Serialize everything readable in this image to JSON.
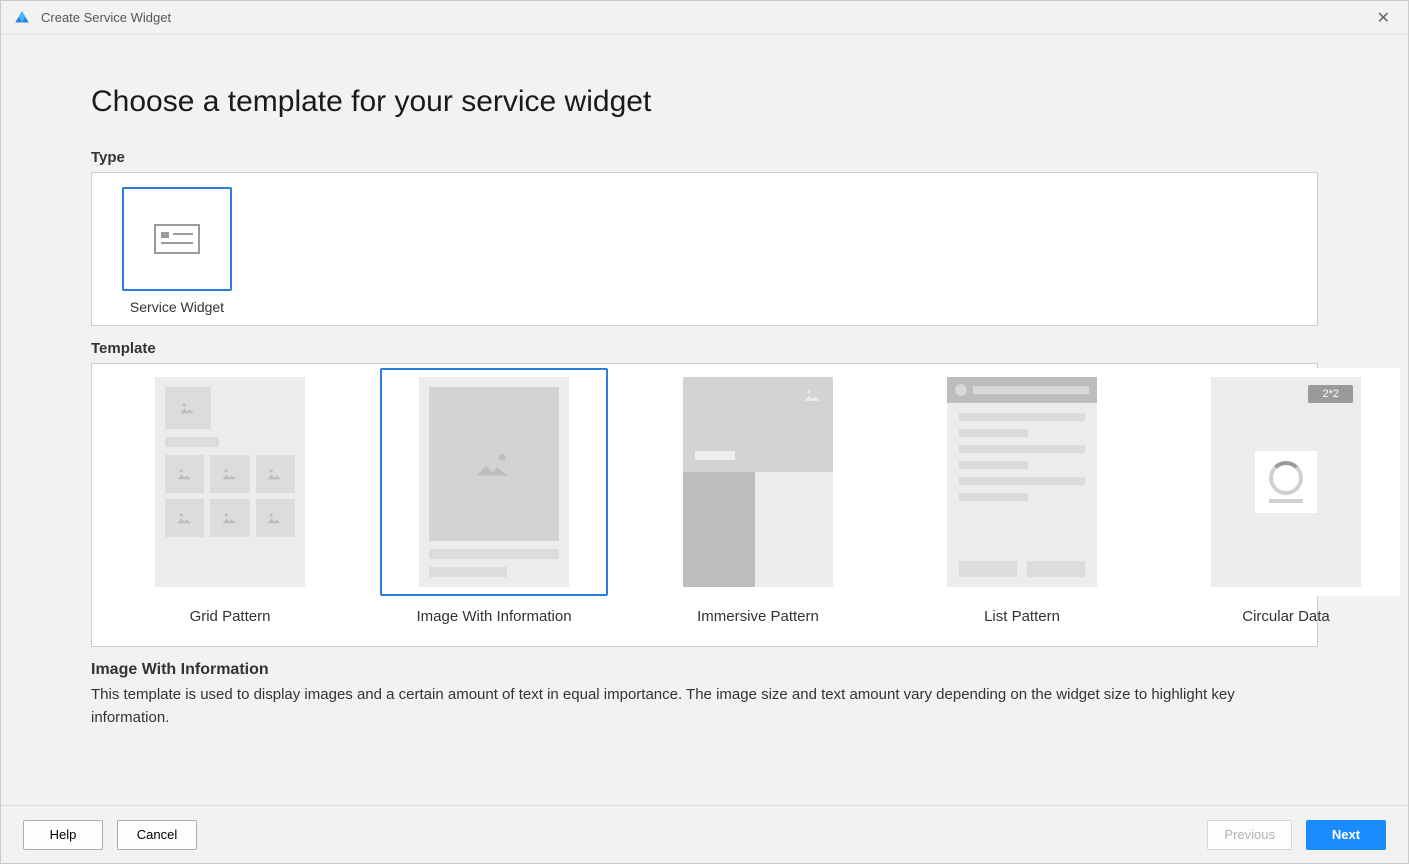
{
  "window": {
    "title": "Create Service Widget"
  },
  "heading": "Choose a template for your service widget",
  "type_section": {
    "label": "Type",
    "cards": [
      {
        "label": "Service Widget"
      }
    ]
  },
  "template_section": {
    "label": "Template",
    "templates": [
      {
        "label": "Grid Pattern"
      },
      {
        "label": "Image With Information"
      },
      {
        "label": "Immersive Pattern"
      },
      {
        "label": "List Pattern"
      },
      {
        "label": "Circular Data"
      }
    ],
    "circular_badge": "2*2"
  },
  "description": {
    "title": "Image With Information",
    "text": "This template is used to display images and a certain amount of text in equal importance. The image size and text amount vary depending on the widget size to highlight key information."
  },
  "buttons": {
    "help": "Help",
    "cancel": "Cancel",
    "previous": "Previous",
    "next": "Next"
  }
}
